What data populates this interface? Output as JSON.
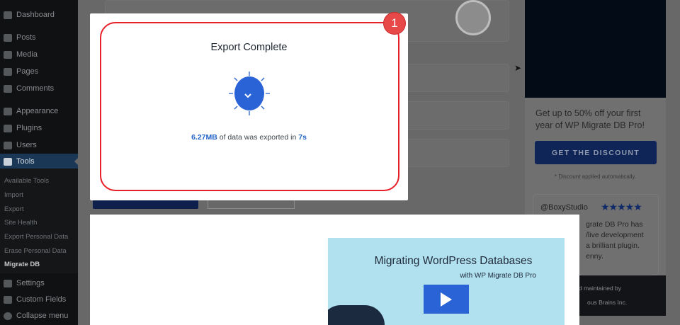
{
  "sidebar": {
    "items": [
      {
        "label": "Dashboard",
        "icon": "dashboard-icon"
      },
      {
        "label": "Posts",
        "icon": "pin-icon"
      },
      {
        "label": "Media",
        "icon": "media-icon"
      },
      {
        "label": "Pages",
        "icon": "pages-icon"
      },
      {
        "label": "Comments",
        "icon": "comment-icon"
      },
      {
        "label": "Appearance",
        "icon": "brush-icon"
      },
      {
        "label": "Plugins",
        "icon": "plugin-icon"
      },
      {
        "label": "Users",
        "icon": "user-icon"
      },
      {
        "label": "Tools",
        "icon": "wrench-icon"
      },
      {
        "label": "Settings",
        "icon": "settings-icon"
      },
      {
        "label": "Custom Fields",
        "icon": "fields-icon"
      },
      {
        "label": "Collapse menu",
        "icon": "collapse-icon"
      }
    ],
    "submenu": [
      "Available Tools",
      "Import",
      "Export",
      "Site Health",
      "Export Personal Data",
      "Erase Personal Data",
      "Migrate DB"
    ]
  },
  "modal": {
    "title": "Export Complete",
    "size": "6.27MB",
    "message": "of data was exported in",
    "time": "7s",
    "badge": "1"
  },
  "promo": {
    "text": "Get up to 50% off your first year of WP Migrate DB Pro!",
    "button": "GET THE DISCOUNT",
    "note": "* Discount applied automatically."
  },
  "review": {
    "handle": "@BoxyStudio",
    "stars": "★★★★★",
    "lines": [
      "grate DB Pro has",
      "/live development",
      "a brilliant plugin.",
      "enny."
    ]
  },
  "footer": {
    "line1": "d maintained by",
    "line2": "ous Brains Inc."
  },
  "video": {
    "title": "Migrating WordPress Databases",
    "subtitle": "with WP Migrate DB Pro"
  }
}
